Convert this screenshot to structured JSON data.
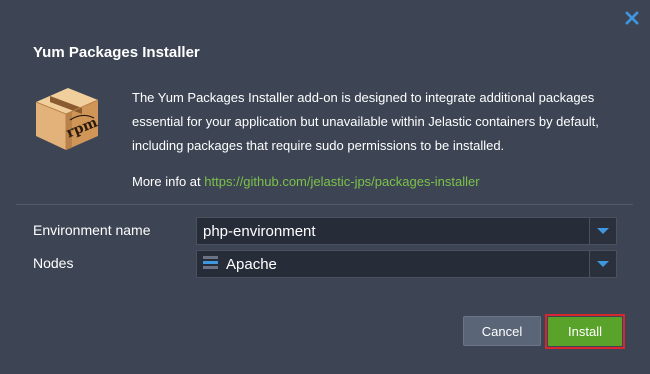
{
  "dialog": {
    "title": "Yum Packages Installer",
    "close_icon": "close-icon",
    "package_icon": "rpm-package-icon",
    "package_icon_text": "rpm",
    "description": "The Yum Packages Installer add-on is designed to integrate additional packages essential for your application but unavailable within Jelastic containers by default, including packages that require sudo permissions to be installed.",
    "more_info_prefix": "More info at",
    "more_info_link": "https://github.com/jelastic-jps/packages-installer"
  },
  "form": {
    "environment": {
      "label": "Environment name",
      "value": "php-environment"
    },
    "nodes": {
      "label": "Nodes",
      "value": "Apache",
      "icon": "server-stack-icon"
    }
  },
  "buttons": {
    "cancel": "Cancel",
    "install": "Install"
  },
  "colors": {
    "background": "#3d4554",
    "link": "#7cc24a",
    "install": "#5aa32a",
    "highlight": "#d6262f",
    "accent": "#3f97e0"
  }
}
